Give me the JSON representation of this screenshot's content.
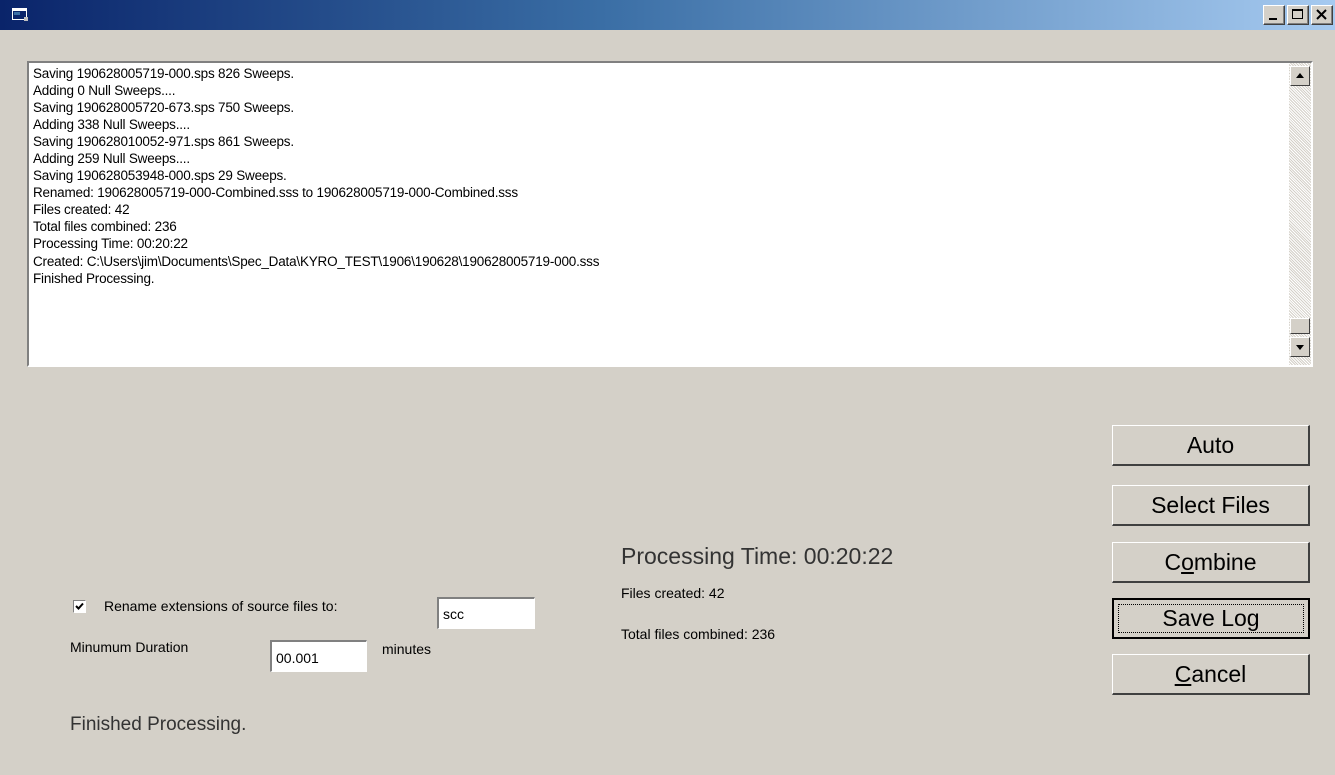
{
  "window": {
    "title": "",
    "icon": "app-window-icon",
    "controls": [
      "minimize",
      "maximize",
      "close"
    ]
  },
  "log": {
    "lines": [
      "Saving 190628005719-000.sps   826 Sweeps.",
      "Adding  0 Null Sweeps....",
      "Saving 190628005720-673.sps   750 Sweeps.",
      "Adding  338 Null Sweeps....",
      "Saving 190628010052-971.sps   861 Sweeps.",
      "Adding  259 Null Sweeps....",
      "Saving 190628053948-000.sps   29 Sweeps.",
      "Renamed: 190628005719-000-Combined.sss  to 190628005719-000-Combined.sss",
      "Files created:  42",
      "Total files combined:  236",
      "Processing Time: 00:20:22",
      "Created: C:\\Users\\jim\\Documents\\Spec_Data\\KYRO_TEST\\1906\\190628\\190628005719-000.sss",
      "Finished Processing."
    ]
  },
  "buttons": {
    "auto": "Auto",
    "select_files": "Select Files",
    "combine_pre": "C",
    "combine_accel": "o",
    "combine_post": "mbine",
    "save_log": "Save Log",
    "cancel_accel": "C",
    "cancel_post": "ancel"
  },
  "options": {
    "rename_checked": true,
    "rename_label": "Rename extensions of source files to:",
    "rename_value": "scc",
    "min_duration_label": "Minumum Duration",
    "min_duration_value": "00.001",
    "min_duration_unit": "minutes"
  },
  "summary": {
    "processing_time": "Processing Time: 00:20:22",
    "files_created": "Files created:  42",
    "total_files_combined": "Total files combined:  236"
  },
  "status": "Finished Processing."
}
